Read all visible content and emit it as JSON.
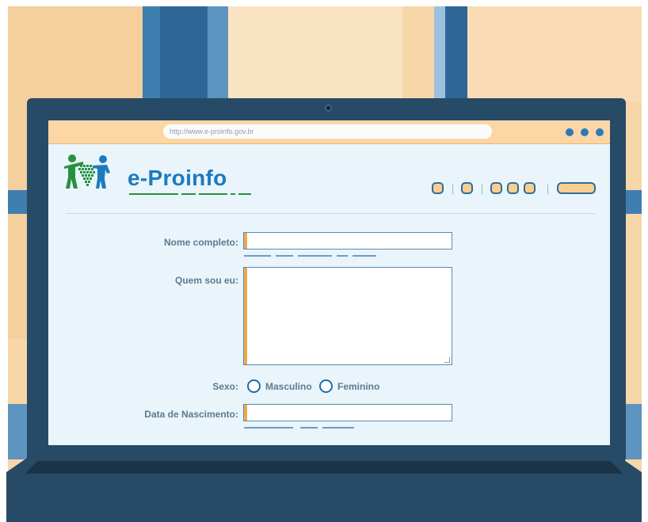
{
  "browser": {
    "url": "http://www.e-proinfo.gov.br",
    "menu_icon": "more-dots-icon"
  },
  "site": {
    "logo_text": "e-Proinfo",
    "logo_icon": "people-map-logo-icon"
  },
  "toolbar": {
    "button_icons": [
      "square-button-icon",
      "square-button-icon",
      "square-button-icon",
      "square-button-icon",
      "square-button-icon",
      "wide-button-icon"
    ]
  },
  "form": {
    "name_label": "Nome completo:",
    "name_value": "",
    "about_label": "Quem sou eu:",
    "about_value": "",
    "sex_label": "Sexo:",
    "sex_options": [
      "Masculino",
      "Feminino"
    ],
    "birth_label": "Data de Nascimento:",
    "birth_value": ""
  },
  "colors": {
    "accent_orange": "#f0a84e",
    "brand_blue": "#1d7bbd",
    "brand_green": "#27913f",
    "frame": "#274a66"
  }
}
